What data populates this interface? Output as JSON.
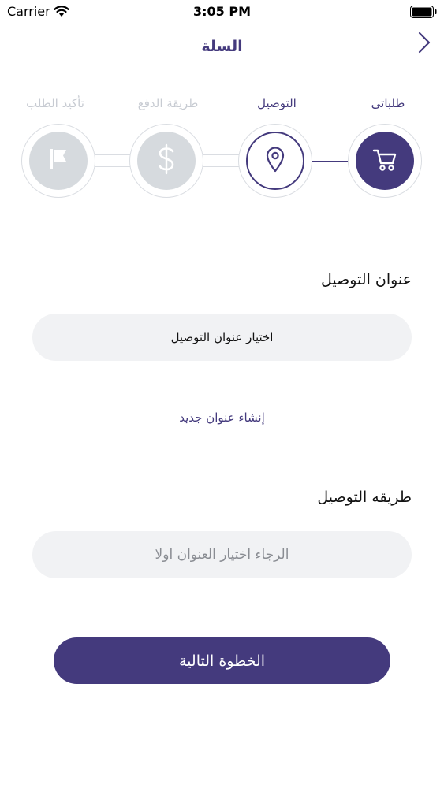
{
  "status_bar": {
    "carrier": "Carrier",
    "time": "3:05 PM"
  },
  "nav": {
    "title": "السلة",
    "back_icon": "chevron-right-icon"
  },
  "stepper": {
    "steps": [
      {
        "label": "طلباتى",
        "state": "done",
        "icon": "cart-icon"
      },
      {
        "label": "التوصيل",
        "state": "current",
        "icon": "location-pin-icon"
      },
      {
        "label": "طريقة الدفع",
        "state": "pending",
        "icon": "dollar-icon"
      },
      {
        "label": "تأكيد الطلب",
        "state": "pending",
        "icon": "flag-icon"
      }
    ]
  },
  "address": {
    "title": "عنوان التوصيل",
    "select_value": "اختيار عنوان التوصيل",
    "new_address_link": "إنشاء عنوان جديد"
  },
  "delivery_method": {
    "title": "طريقه التوصيل",
    "placeholder": "الرجاء اختيار العنوان اولا"
  },
  "next_button": {
    "label": "الخطوة التالية"
  },
  "colors": {
    "primary": "#443a7d",
    "inactive_circle": "#d6dade",
    "inactive_text": "#c7cbd2",
    "field_bg": "#f1f2f4"
  }
}
